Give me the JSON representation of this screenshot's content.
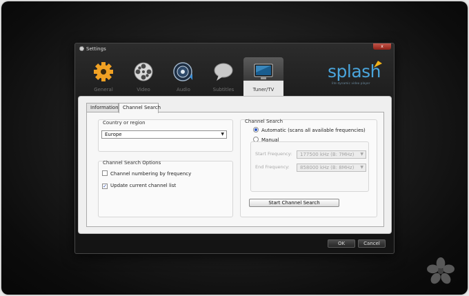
{
  "window": {
    "title": "Settings",
    "close_label": "x"
  },
  "tabs": [
    {
      "label": "General",
      "icon": "gear-icon",
      "active": false
    },
    {
      "label": "Video",
      "icon": "film-reel-icon",
      "active": false
    },
    {
      "label": "Audio",
      "icon": "speaker-icon",
      "active": false
    },
    {
      "label": "Subtitles",
      "icon": "speech-bubble-icon",
      "active": false
    },
    {
      "label": "Tuner/TV",
      "icon": "tv-monitor-icon",
      "active": true
    }
  ],
  "brand": {
    "name": "splash",
    "tagline": "lite dynamic video player"
  },
  "subtabs": [
    {
      "label": "Information",
      "active": false
    },
    {
      "label": "Channel Search",
      "active": true
    }
  ],
  "country": {
    "title": "Country or region",
    "value": "Europe"
  },
  "options": {
    "title": "Channel Search Options",
    "items": [
      {
        "label": "Channel numbering by frequency",
        "checked": false
      },
      {
        "label": "Update current channel list",
        "checked": true
      }
    ]
  },
  "search": {
    "title": "Channel Search",
    "automatic_label": "Automatic (scans all available frequencies)",
    "manual_label": "Manual",
    "start_label": "Start Frequency:",
    "start_value": "177500 kHz (B: 7MHz)",
    "end_label": "End Frequency:",
    "end_value": "858000 kHz (B: 8MHz)",
    "button_label": "Start Channel Search"
  },
  "footer": {
    "ok_label": "OK",
    "cancel_label": "Cancel"
  },
  "colors": {
    "accent": "#4aa5dc",
    "close": "#b23a2e"
  }
}
